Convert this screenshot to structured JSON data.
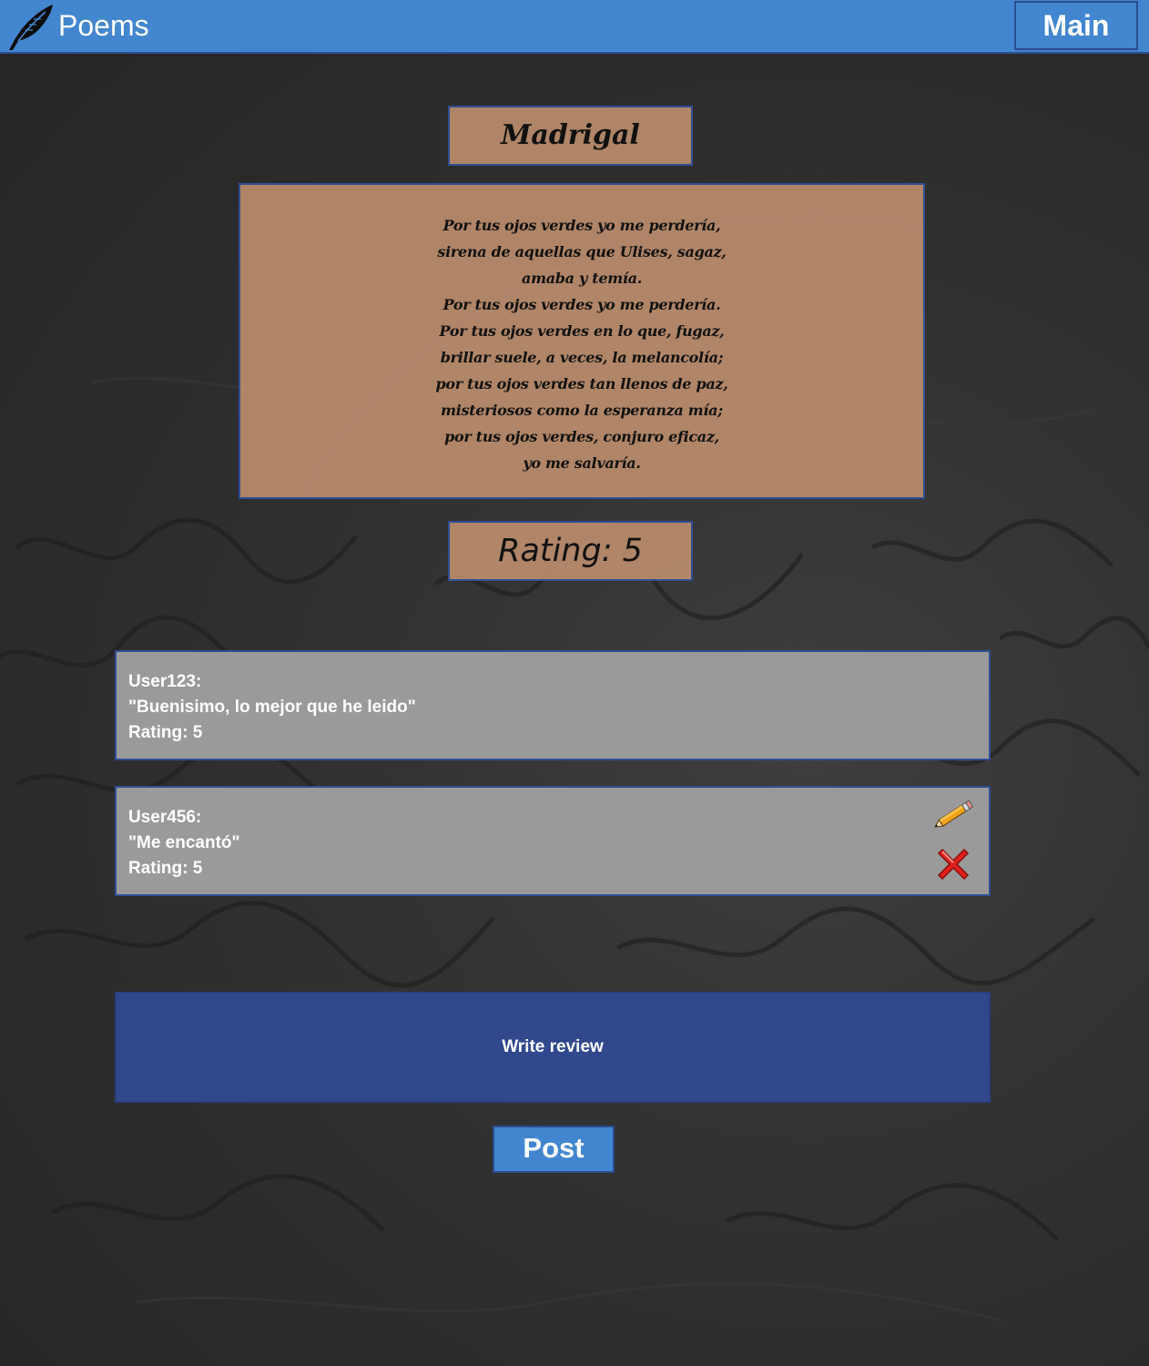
{
  "header": {
    "brand": "Poems",
    "main_button": "Main",
    "logo_icon": "quill-feather-icon"
  },
  "poem": {
    "title": "Madrigal",
    "lines": [
      "Por tus ojos verdes yo me perdería,",
      "sirena de aquellas que Ulises, sagaz,",
      "amaba y temía.",
      "Por tus ojos verdes yo me perdería.",
      "Por tus ojos verdes en lo que, fugaz,",
      "brillar suele, a veces, la melancolía;",
      "por tus ojos verdes tan llenos de paz,",
      "misteriosos como la esperanza mía;",
      "por tus ojos verdes, conjuro eficaz,",
      "yo me salvaría."
    ],
    "rating_label": "Rating: 5"
  },
  "reviews": [
    {
      "user": "User123:",
      "text": "\"Buenisimo, lo mejor que he leido\"",
      "rating": "Rating: 5"
    },
    {
      "user": "User456:",
      "text": "\"Me encantó\"",
      "rating": "Rating: 5",
      "edit_icon": "pencil-icon",
      "delete_icon": "red-x-icon"
    }
  ],
  "compose": {
    "placeholder": "Write review",
    "post_label": "Post"
  },
  "colors": {
    "header": "#4286cf",
    "border": "#2f4e95",
    "card_tan": "#c29170",
    "review_gray": "#9a9a9a",
    "compose_blue": "#314a94"
  }
}
